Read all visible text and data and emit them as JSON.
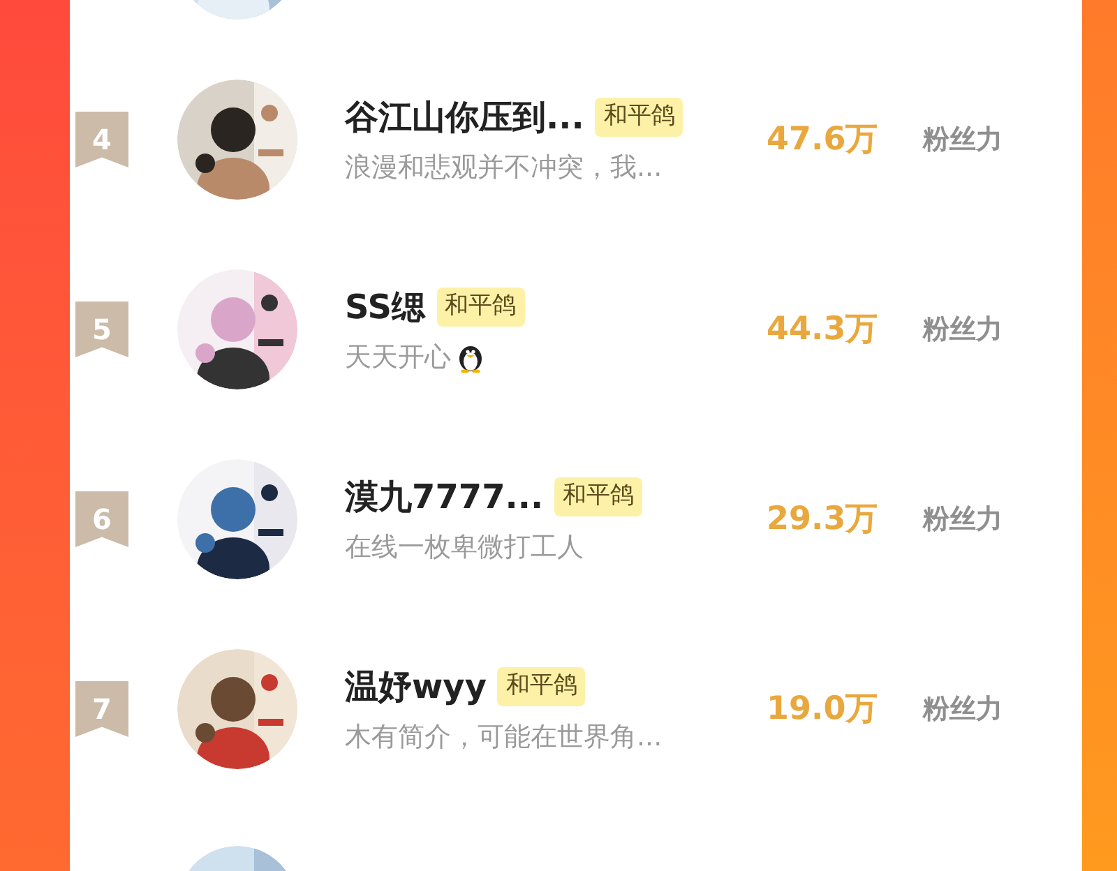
{
  "entries": [
    {
      "rank": "4",
      "name": "谷江山你压到...",
      "tag": "和平鸽",
      "bio": "浪漫和悲观并不冲突，我...",
      "bio_icon": false,
      "fans": "47.6万",
      "unit": "粉丝力"
    },
    {
      "rank": "5",
      "name": "SS缌",
      "tag": "和平鸽",
      "bio": "天天开心",
      "bio_icon": true,
      "fans": "44.3万",
      "unit": "粉丝力"
    },
    {
      "rank": "6",
      "name": "漠九7777...",
      "tag": "和平鸽",
      "bio": "在线一枚卑微打工人",
      "bio_icon": false,
      "fans": "29.3万",
      "unit": "粉丝力"
    },
    {
      "rank": "7",
      "name": "温妤wyy",
      "tag": "和平鸽",
      "bio": "木有简介，可能在世界角...",
      "bio_icon": false,
      "fans": "19.0万",
      "unit": "粉丝力"
    }
  ]
}
